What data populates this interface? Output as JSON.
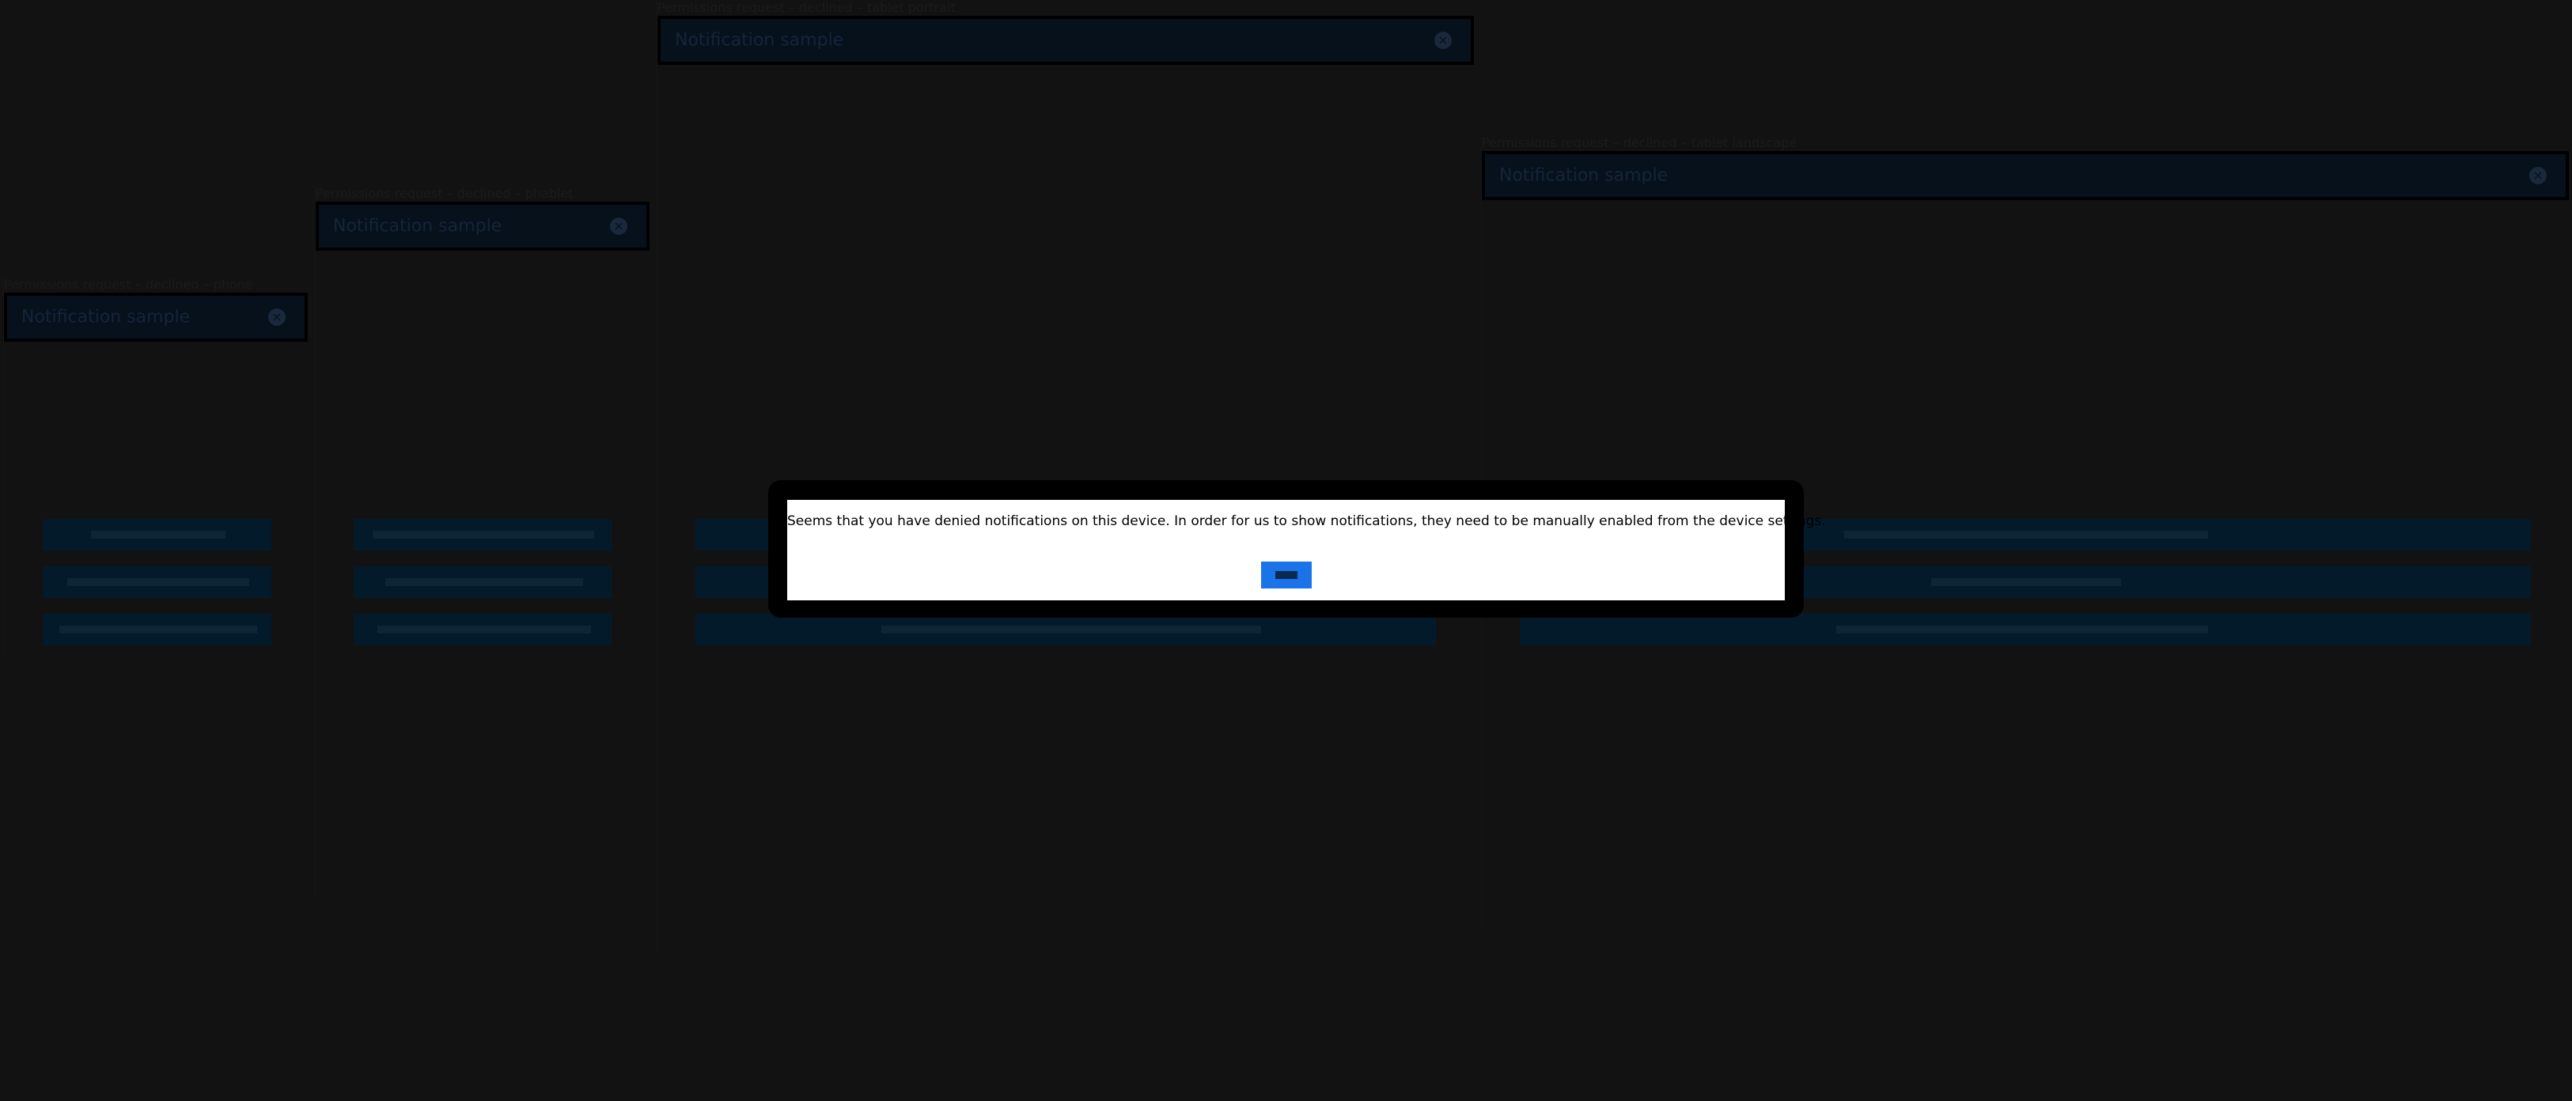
{
  "previews": {
    "phone": {
      "label": "Permissions request – declined – phone",
      "notification_title": "Notification sample"
    },
    "phablet_portrait": {
      "label": "Permissions request – declined – phablet",
      "notification_title": "Notification sample"
    },
    "tablet_portrait": {
      "label": "Permissions request – declined – tablet portrait",
      "notification_title": "Notification sample"
    },
    "tablet_landscape": {
      "label": "Permissions request – declined – tablet landscape",
      "notification_title": "Notification sample"
    }
  },
  "dialog": {
    "message": "Seems that you have denied notifications on this device. In order for us to show notifications, they need to be manually enabled from the device settings.",
    "ok_label": "OK"
  },
  "colors": {
    "background": "#121212",
    "dialog_background": "#ffffff",
    "dialog_frame": "#000000",
    "button_accent": "#1a73e8"
  }
}
